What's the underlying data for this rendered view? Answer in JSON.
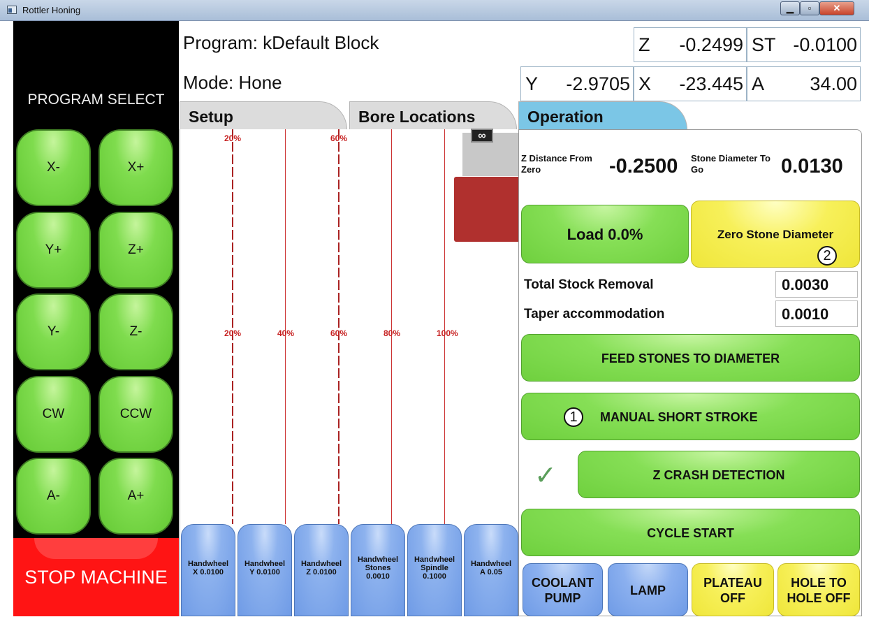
{
  "window": {
    "title": "Rottler Honing",
    "min": "▁",
    "max": "▫",
    "close": "✕"
  },
  "left": {
    "program_select": "PROGRAM SELECT",
    "jog": [
      "X-",
      "X+",
      "Y+",
      "Z+",
      "Y-",
      "Z-",
      "CW",
      "CCW",
      "A-",
      "A+"
    ],
    "stop": "STOP MACHINE"
  },
  "header": {
    "program": "Program: kDefault Block",
    "mode": "Mode: Hone",
    "readouts": {
      "z": {
        "label": "Z",
        "value": "-0.2499"
      },
      "st": {
        "label": "ST",
        "value": "-0.0100"
      },
      "y": {
        "label": "Y",
        "value": "-2.9705"
      },
      "x": {
        "label": "X",
        "value": "-23.445"
      },
      "a": {
        "label": "A",
        "value": "34.00"
      }
    }
  },
  "tabs": [
    "Setup",
    "Bore Locations",
    "Operation"
  ],
  "graph": {
    "top_labels": [
      "20%",
      "60%"
    ],
    "mid_labels": [
      "20%",
      "40%",
      "60%",
      "80%",
      "100%"
    ],
    "gauge_icon": "∞"
  },
  "handwheels": [
    {
      "name": "Handwheel",
      "detail": "X 0.0100"
    },
    {
      "name": "Handwheel",
      "detail": "Y 0.0100"
    },
    {
      "name": "Handwheel",
      "detail": "Z 0.0100"
    },
    {
      "name": "Handwheel",
      "detail": "Stones 0.0010"
    },
    {
      "name": "Handwheel",
      "detail": "Spindle 0.1000"
    },
    {
      "name": "Handwheel",
      "detail": "A 0.05"
    }
  ],
  "operation": {
    "z_dist_label": "Z Distance From Zero",
    "z_dist_value": "-0.2500",
    "stone_diam_label": "Stone Diameter To Go",
    "stone_diam_value": "0.0130",
    "load": "Load 0.0%",
    "zero_stone": "Zero Stone Diameter",
    "badge2": "2",
    "total_stock_label": "Total Stock Removal",
    "total_stock_value": "0.0030",
    "taper_label": "Taper accommodation",
    "taper_value": "0.0010",
    "feed": "FEED STONES TO DIAMETER",
    "badge1": "1",
    "manual": "MANUAL SHORT STROKE",
    "check": "✓",
    "crash": "Z CRASH DETECTION",
    "cycle": "CYCLE START",
    "coolant": "COOLANT PUMP",
    "lamp": "LAMP",
    "plateau": "PLATEAU OFF",
    "hole": "HOLE TO HOLE OFF"
  }
}
